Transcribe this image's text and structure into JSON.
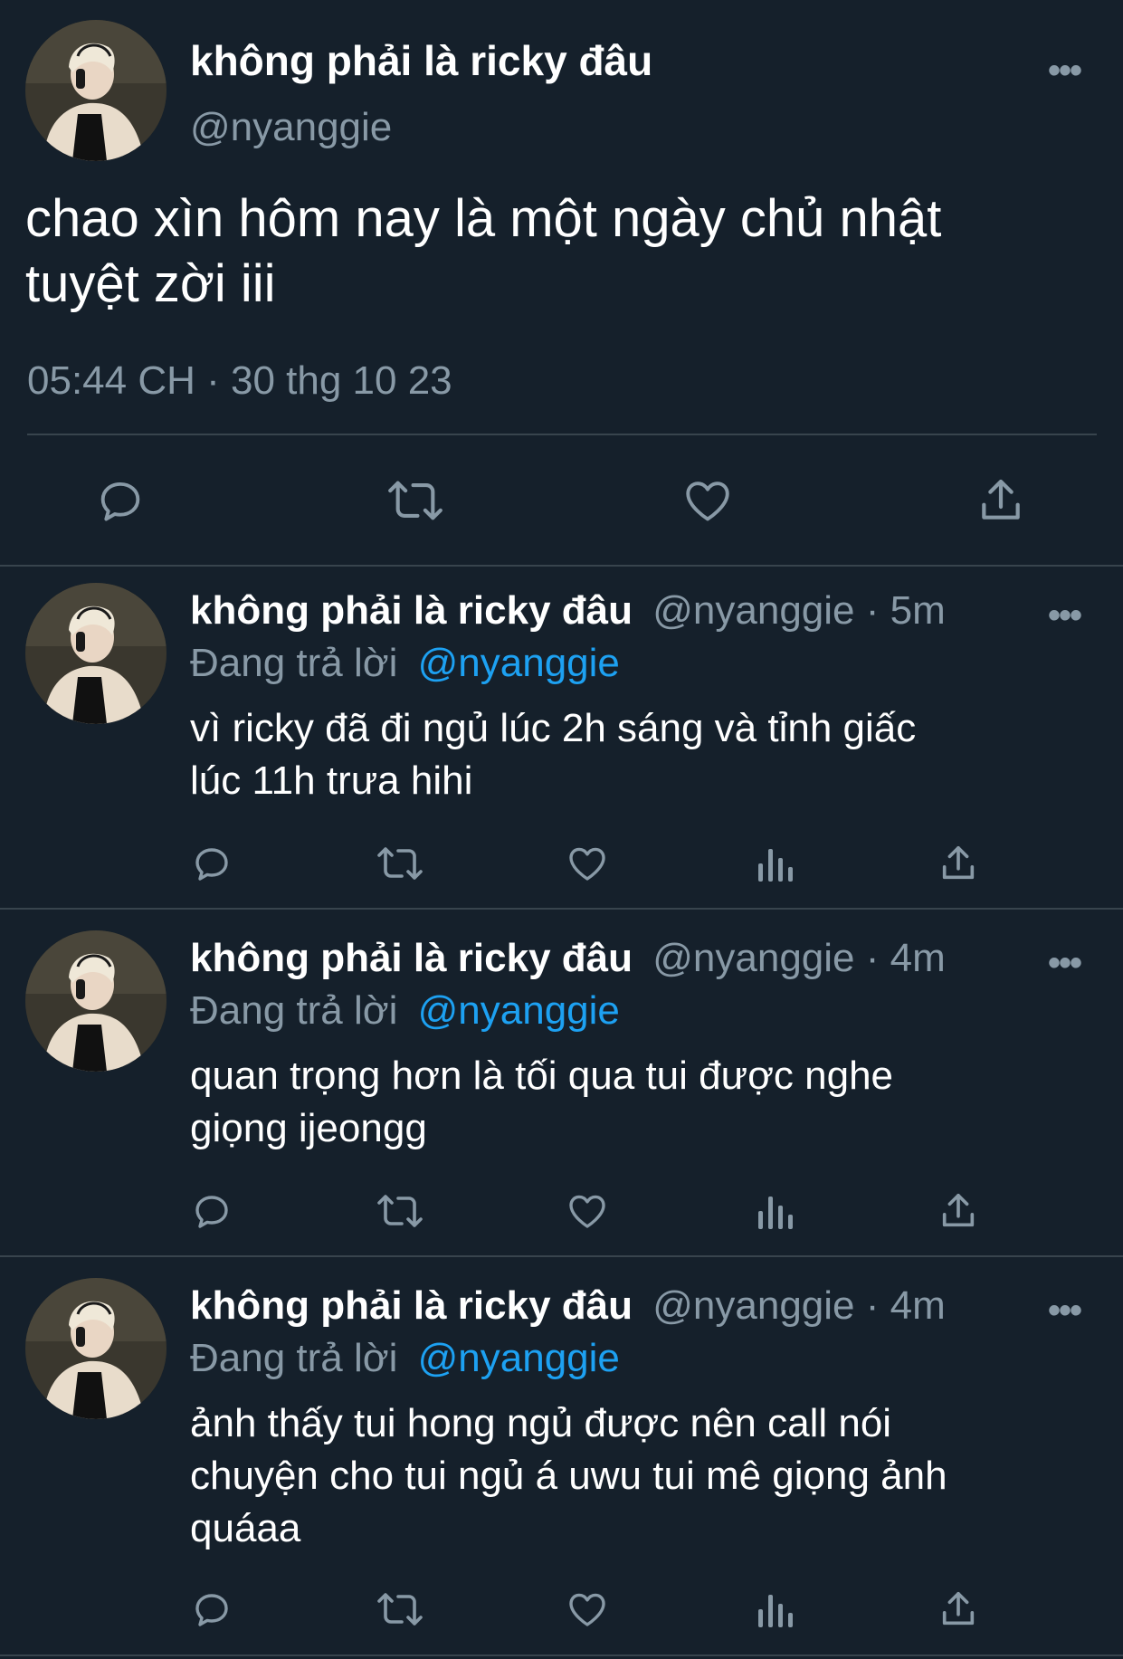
{
  "main_tweet": {
    "display_name": "không phải là ricky đâu",
    "handle": "@nyanggie",
    "text_line1": "chao xìn hôm nay là một ngày chủ nhật",
    "text_line2": "tuyệt zời iii",
    "timestamp": "05:44 CH · 30 thg 10 23",
    "more_label": "•••",
    "action_icons": [
      "reply-icon",
      "retweet-icon",
      "like-icon",
      "share-icon"
    ]
  },
  "replies": [
    {
      "display_name": "không phải là ricky đâu",
      "handle_time": "@nyanggie · 5m",
      "replying_prefix": "Đang trả lời",
      "replying_to": "@nyanggie",
      "text_lines": [
        "vì ricky đã đi ngủ lúc 2h sáng và tỉnh giấc",
        "lúc 11h trưa hihi"
      ],
      "more_label": "•••"
    },
    {
      "display_name": "không phải là ricky đâu",
      "handle_time": "@nyanggie · 4m",
      "replying_prefix": "Đang trả lời",
      "replying_to": "@nyanggie",
      "text_lines": [
        "quan trọng hơn là tối qua tui được nghe",
        "giọng ijeongg"
      ],
      "more_label": "•••"
    },
    {
      "display_name": "không phải là ricky đâu",
      "handle_time": "@nyanggie · 4m",
      "replying_prefix": "Đang trả lời",
      "replying_to": "@nyanggie",
      "text_lines": [
        "ảnh thấy tui hong ngủ được nên call nói",
        "chuyện cho tui ngủ á uwu tui mê giọng ảnh",
        "quáaa"
      ],
      "more_label": "•••"
    }
  ],
  "reply_action_icons": [
    "reply-icon",
    "retweet-icon",
    "like-icon",
    "analytics-icon",
    "share-icon"
  ],
  "colors": {
    "background": "#15202b",
    "secondary_text": "#8899a6",
    "mention": "#1da1f2",
    "divider": "#38444d"
  }
}
